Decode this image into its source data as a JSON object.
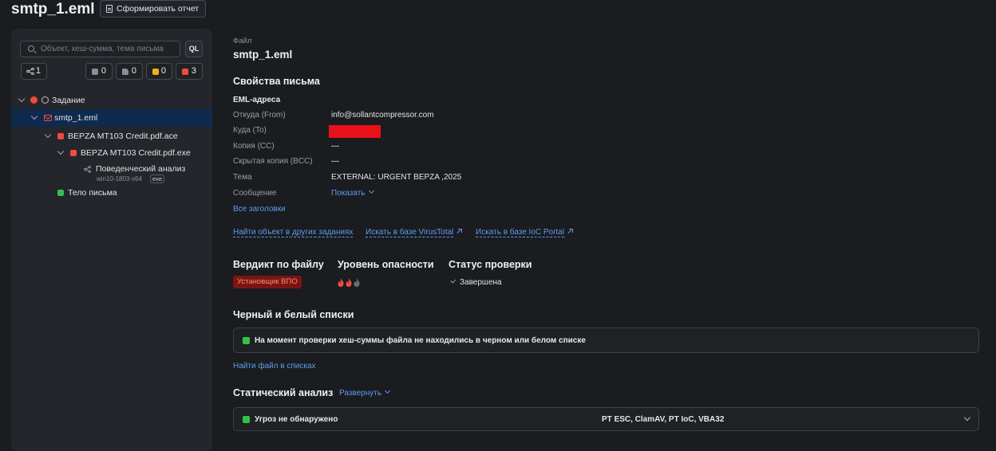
{
  "header": {
    "title": "smtp_1.eml",
    "report_button": "Сформировать отчет"
  },
  "sidebar": {
    "search_placeholder": "Объект, хеш-сумма, тема письма",
    "ql_label": "QL",
    "chips": {
      "links_count": "1",
      "gray_count": "0",
      "file_count": "0",
      "yellow_count": "0",
      "red_count": "3"
    },
    "tree": [
      {
        "label": "Задание"
      },
      {
        "label": "smtp_1.eml"
      },
      {
        "label": "BEPZA MT103 Credit.pdf.ace"
      },
      {
        "label": "BEPZA MT103 Credit.pdf.exe"
      },
      {
        "label": "Поведенческий анализ",
        "sub": "win10-1803-x64",
        "badge": "exe"
      },
      {
        "label": "Тело письма"
      }
    ]
  },
  "main": {
    "file_caption": "Файл",
    "file_name": "smtp_1.eml",
    "props_title": "Свойства письма",
    "eml_title": "EML-адреса",
    "props": {
      "from_label": "Откуда (From)",
      "from_value": "info@sollantcompressor.com",
      "to_label": "Куда (To)",
      "cc_label": "Копия (CC)",
      "cc_value": "—",
      "bcc_label": "Скрытая копия (BCC)",
      "bcc_value": "—",
      "subject_label": "Тема",
      "subject_value": "EXTERNAL: URGENT BEPZA ,2025",
      "message_label": "Сообщение",
      "message_value": "Показать"
    },
    "all_headers": "Все заголовки",
    "links": {
      "find_other": "Найти объект в других заданиях",
      "virustotal": "Искать в базе VirusTotal",
      "ioc_portal": "Искать в базе IoC Portal"
    },
    "verdict": {
      "verdict_title": "Вердикт по файлу",
      "verdict_value": "Установщик ВПО",
      "danger_title": "Уровень опасности",
      "danger_level": 2,
      "danger_max": 3,
      "status_title": "Статус проверки",
      "status_value": "Завершена"
    },
    "lists": {
      "title": "Черный и белый списки",
      "message": "На момент проверки хеш-суммы файла не находились в черном или белом списке",
      "find_link": "Найти файл в списках"
    },
    "static": {
      "title": "Статический анализ",
      "expand": "Развернуть",
      "result": "Угроз не обнаружено",
      "engines": "PT ESC, ClamAV, PT IoC, VBA32"
    }
  },
  "colors": {
    "accent_blue": "#5b9cf2",
    "danger_red": "#ee4c3e",
    "ok_green": "#33c14b",
    "warn_yellow": "#f2b01e"
  }
}
